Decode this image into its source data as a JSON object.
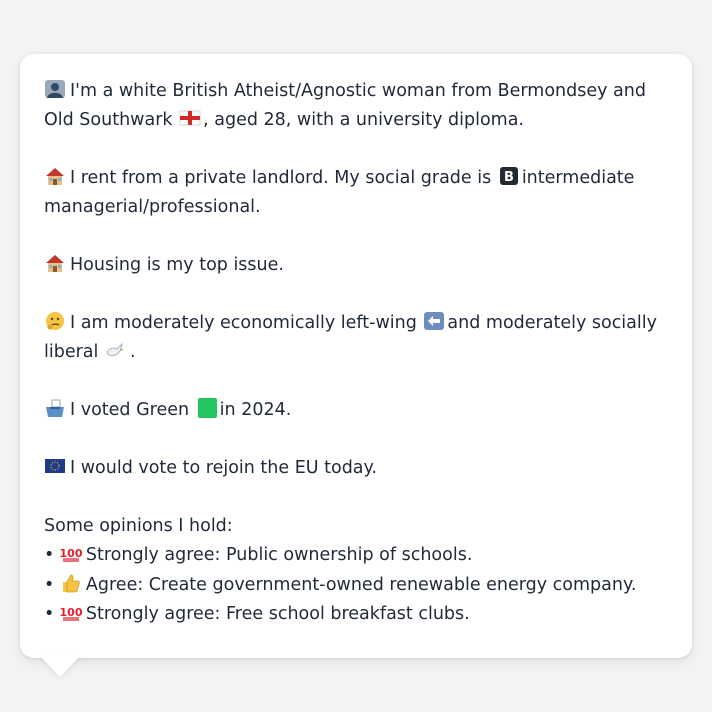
{
  "profile": {
    "identity_text_a": "I'm a white British Atheist/Agnostic woman from Bermondsey and Old Southwark",
    "identity_text_b": ", aged 28, with a university diploma.",
    "housing_text_a": "I rent from a private landlord. My social grade is",
    "housing_text_b": "intermediate managerial/professional.",
    "top_issue_text": "Housing is my top issue.",
    "ideology_text_a": "I am moderately economically left-wing",
    "ideology_text_b": "and moderately socially liberal",
    "ideology_text_c": ".",
    "vote_text_a": "I voted Green",
    "vote_text_b": "in 2024.",
    "eu_text": "I would vote to rejoin the EU today."
  },
  "opinions": {
    "title": "Some opinions I hold:",
    "items": [
      {
        "bullet": "•",
        "stance": "Strongly agree: Public ownership of schools."
      },
      {
        "bullet": "•",
        "stance": "Agree: Create government-owned renewable energy company."
      },
      {
        "bullet": "•",
        "stance": "Strongly agree: Free school breakfast clubs."
      }
    ]
  },
  "icons": {
    "person": "bust-in-silhouette-icon",
    "england_flag": "england-flag-icon",
    "house": "house-icon",
    "grade_b": "b-button-icon",
    "thinking": "thinking-face-icon",
    "left_arrow": "left-arrow-icon",
    "dove": "dove-icon",
    "ballot_box": "ballot-box-icon",
    "green_square": "green-square-icon",
    "eu_flag": "eu-flag-icon",
    "hundred": "hundred-points-icon",
    "thumbs_up": "thumbs-up-icon"
  },
  "colors": {
    "background": "#f3f4f6",
    "bubble": "#ffffff",
    "text": "#1f2937",
    "green_party": "#22c55e",
    "eu_blue": "#1e3a8a"
  }
}
